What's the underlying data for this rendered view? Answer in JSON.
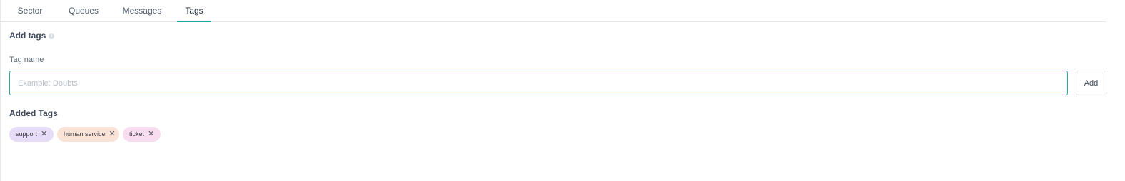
{
  "tabs": [
    {
      "label": "Sector",
      "active": false
    },
    {
      "label": "Queues",
      "active": false
    },
    {
      "label": "Messages",
      "active": false
    },
    {
      "label": "Tags",
      "active": true
    }
  ],
  "add_tags": {
    "title": "Add tags",
    "info_icon": "info-icon",
    "field_label": "Tag name",
    "input_placeholder": "Example: Doubts",
    "input_value": "",
    "add_button_label": "Add"
  },
  "added_tags": {
    "title": "Added Tags",
    "remove_icon": "close-icon",
    "remove_glyph": "✕",
    "items": [
      {
        "label": "support",
        "color": "#e6dcf7"
      },
      {
        "label": "human service",
        "color": "#f9e2d6"
      },
      {
        "label": "ticket",
        "color": "#f8dcef"
      }
    ]
  },
  "colors": {
    "accent": "#1fa7a2",
    "input_border": "#2aa8a3"
  }
}
